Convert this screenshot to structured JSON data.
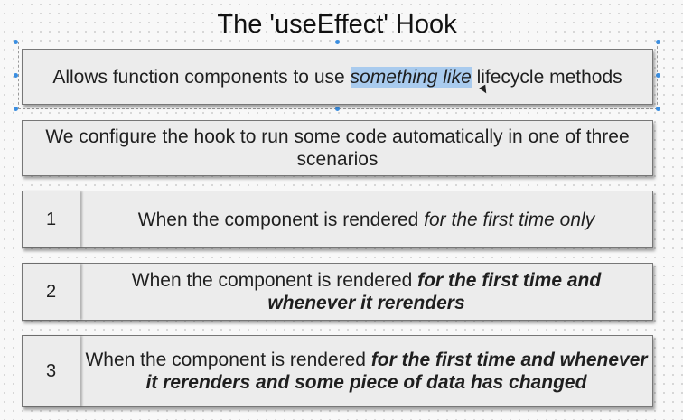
{
  "title": "The 'useEffect' Hook",
  "summary": {
    "before": "Allows function components to use ",
    "highlighted": "something like",
    "after": " lifecycle methods"
  },
  "intro": "We configure the hook to run some code automatically in one of three scenarios",
  "scenarios": [
    {
      "number": "1",
      "plain": "When the component is rendered ",
      "emphasis": "for the first time only",
      "emphasis_style": "italic"
    },
    {
      "number": "2",
      "plain": "When the component is rendered ",
      "emphasis": "for the first time and whenever it rerenders",
      "emphasis_style": "bold-italic"
    },
    {
      "number": "3",
      "plain": "When the component is rendered ",
      "emphasis": "for the first time and whenever it rerenders and some piece of data has changed",
      "emphasis_style": "bold-italic"
    }
  ],
  "colors": {
    "selection_handle": "#3b8ee0",
    "text_highlight": "#a9cbee",
    "box_fill": "#ececec"
  }
}
